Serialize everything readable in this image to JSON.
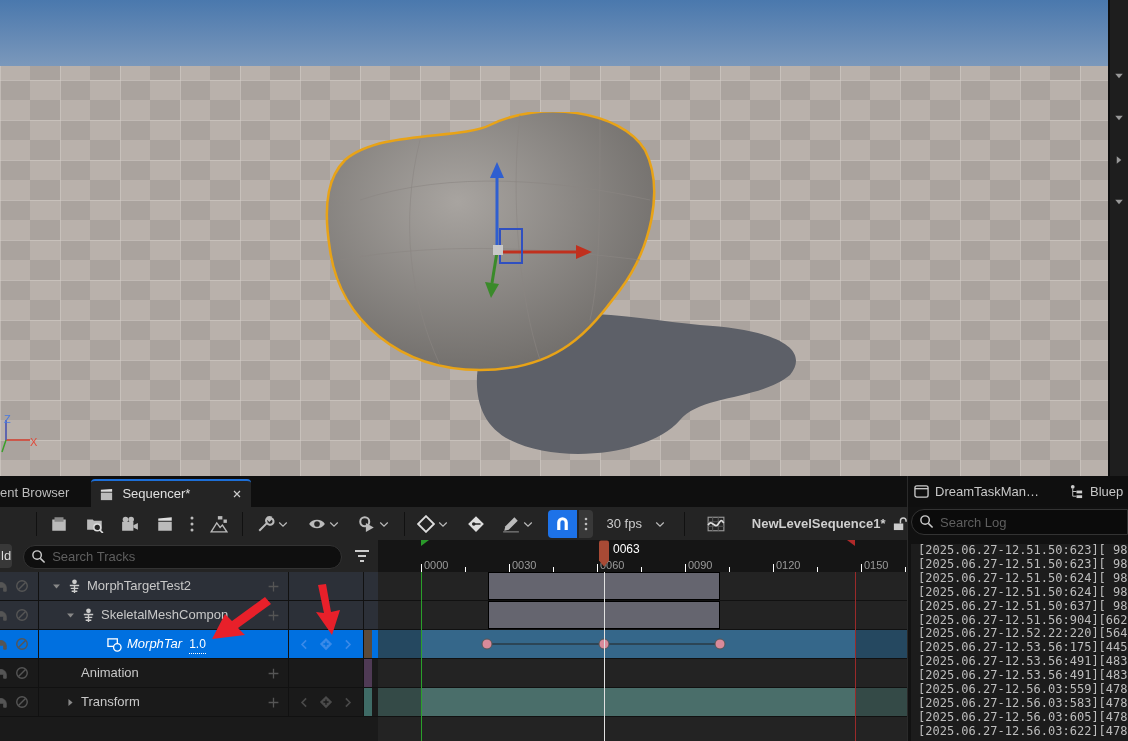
{
  "viewport": {
    "axis_labels": [
      "Z",
      "X"
    ]
  },
  "tabs": [
    {
      "label": "ent Browser",
      "selected": false,
      "closable": false
    },
    {
      "label": "Sequencer*",
      "selected": true,
      "closable": true
    }
  ],
  "side_tabs": [
    {
      "label": "DreamTaskMan…",
      "kind": "window"
    },
    {
      "label": "Bluep",
      "kind": "blueprint"
    }
  ],
  "toolbar": {
    "fps": "30 fps",
    "sequence_name": "NewLevelSequence1*",
    "snap_on": true,
    "locked": false
  },
  "track_bar": {
    "add_button": "ld",
    "search_placeholder": "Search Tracks"
  },
  "timeline": {
    "ticks": [
      "0000",
      "0030",
      "0060",
      "0090",
      "0120",
      "0150"
    ],
    "playhead": "0063"
  },
  "tracks": [
    {
      "label": "MorphTargetTest2",
      "kind": "actor",
      "expanded": true,
      "selected": false,
      "children": [
        {
          "label": "SkeletalMeshCompon",
          "kind": "component",
          "expanded": true,
          "selected": false,
          "children": [
            {
              "label": "MorphTar",
              "kind": "morph",
              "value": "1.0",
              "selected": true,
              "key_buttons": true,
              "color": "#5b4a3a"
            }
          ]
        },
        {
          "label": "Animation",
          "kind": "animation",
          "selected": false,
          "color": "#4f3a55"
        },
        {
          "label": "Transform",
          "kind": "transform",
          "expanded": false,
          "selected": false,
          "key_buttons": true,
          "color": "#3f6b66"
        }
      ]
    }
  ],
  "log": {
    "search_placeholder": "Search Log",
    "lines": [
      "[2025.06.27-12.51.50:623][ 98",
      "[2025.06.27-12.51.50:623][ 98",
      "[2025.06.27-12.51.50:624][ 98",
      "[2025.06.27-12.51.50:624][ 98",
      "[2025.06.27-12.51.50:637][ 98",
      "[2025.06.27-12.51.56:904][662",
      "[2025.06.27-12.52.22:220][564",
      "[2025.06.27-12.53.56:175][445",
      "[2025.06.27-12.53.56:491][483",
      "[2025.06.27-12.53.56:491][483",
      "[2025.06.27-12.56.03:559][478",
      "[2025.06.27-12.56.03:583][478",
      "[2025.06.27-12.56.03:605][478",
      "[2025.06.27-12.56.03:622][478"
    ]
  }
}
